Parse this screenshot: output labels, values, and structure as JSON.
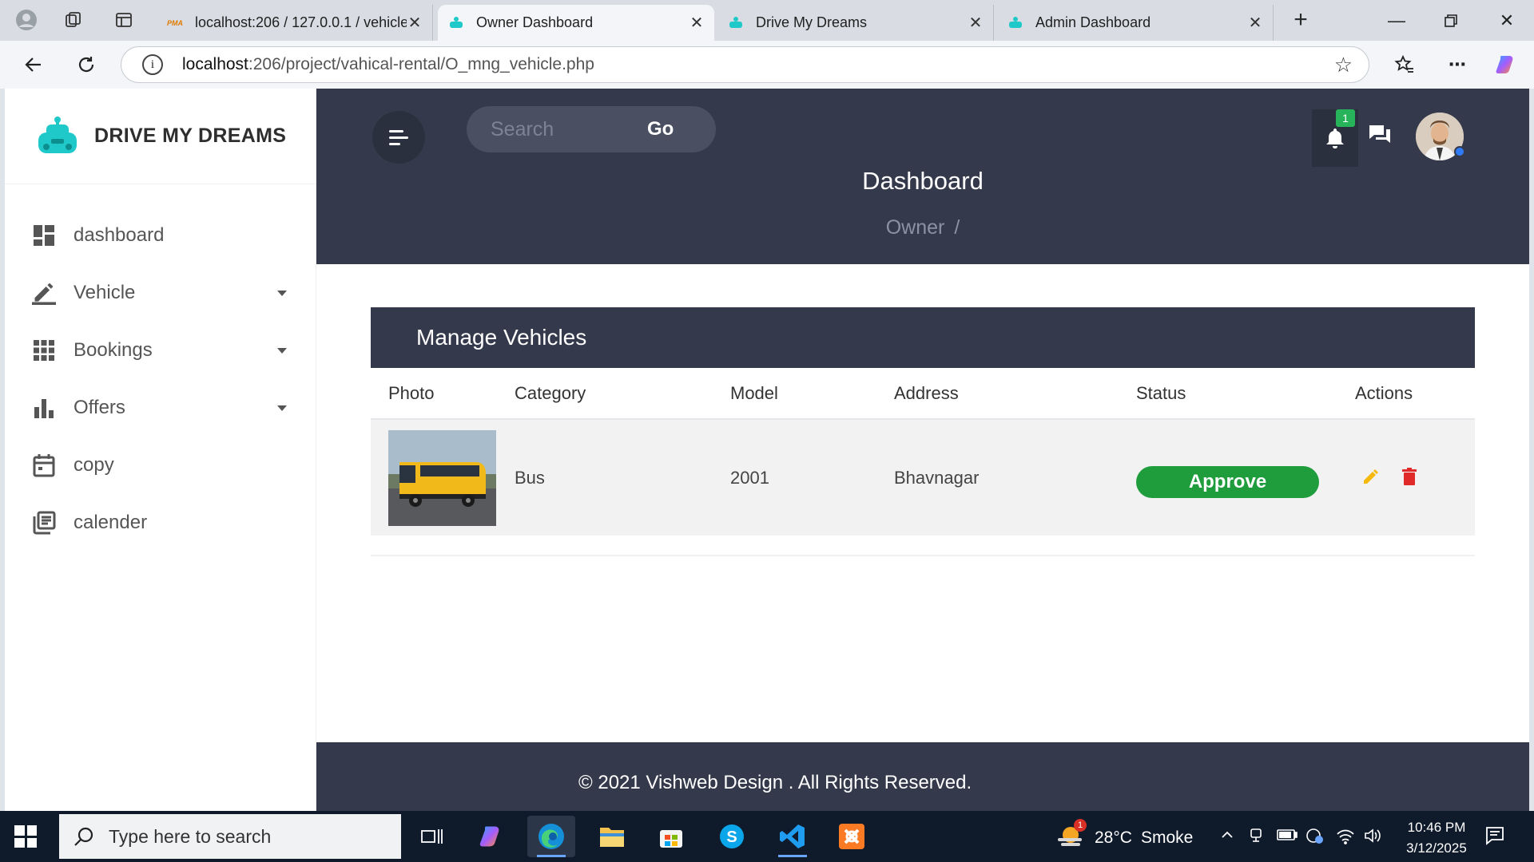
{
  "browser": {
    "tabs": [
      {
        "title": "localhost:206 / 127.0.0.1 / vehicle",
        "favicon": "phpmyadmin-icon",
        "active": false
      },
      {
        "title": "Owner Dashboard",
        "favicon": "car-logo-icon",
        "active": true
      },
      {
        "title": "Drive My Dreams",
        "favicon": "car-logo-icon",
        "active": false
      },
      {
        "title": "Admin Dashboard",
        "favicon": "car-logo-icon",
        "active": false
      }
    ],
    "url_host": "localhost",
    "url_path": ":206/project/vahical-rental/O_mng_vehicle.php"
  },
  "sidebar": {
    "brand": "DRIVE MY DREAMS",
    "items": [
      {
        "label": "dashboard",
        "icon": "dashboard-icon",
        "has_caret": false
      },
      {
        "label": "Vehicle",
        "icon": "pencil-icon",
        "has_caret": true
      },
      {
        "label": "Bookings",
        "icon": "apps-grid-icon",
        "has_caret": true
      },
      {
        "label": "Offers",
        "icon": "bar-chart-icon",
        "has_caret": true
      },
      {
        "label": "copy",
        "icon": "calendar-icon",
        "has_caret": false
      },
      {
        "label": "calender",
        "icon": "library-icon",
        "has_caret": false
      }
    ]
  },
  "topbar": {
    "search_placeholder": "Search",
    "search_button": "Go",
    "notification_count": "1",
    "page_title": "Dashboard",
    "breadcrumb": "Owner",
    "breadcrumb_sep": "/"
  },
  "vehicles": {
    "heading": "Manage Vehicles",
    "columns": [
      "Photo",
      "Category",
      "Model",
      "Address",
      "Status",
      "Actions"
    ],
    "rows": [
      {
        "category": "Bus",
        "model": "2001",
        "address": "Bhavnagar",
        "status": "Approve"
      }
    ]
  },
  "footer": {
    "text": "© 2021 Vishweb Design . All Rights Reserved."
  },
  "taskbar": {
    "search_placeholder": "Type here to search",
    "weather_temp": "28°C",
    "weather_desc": "Smoke",
    "weather_alert": "1",
    "time": "10:46 PM",
    "date": "3/12/2025"
  },
  "colors": {
    "topbar_bg": "#343a4b",
    "status_green": "#1f9d3c",
    "edit_yellow": "#f5b90b",
    "delete_red": "#e02a2a",
    "badge_green": "#27b35a"
  }
}
